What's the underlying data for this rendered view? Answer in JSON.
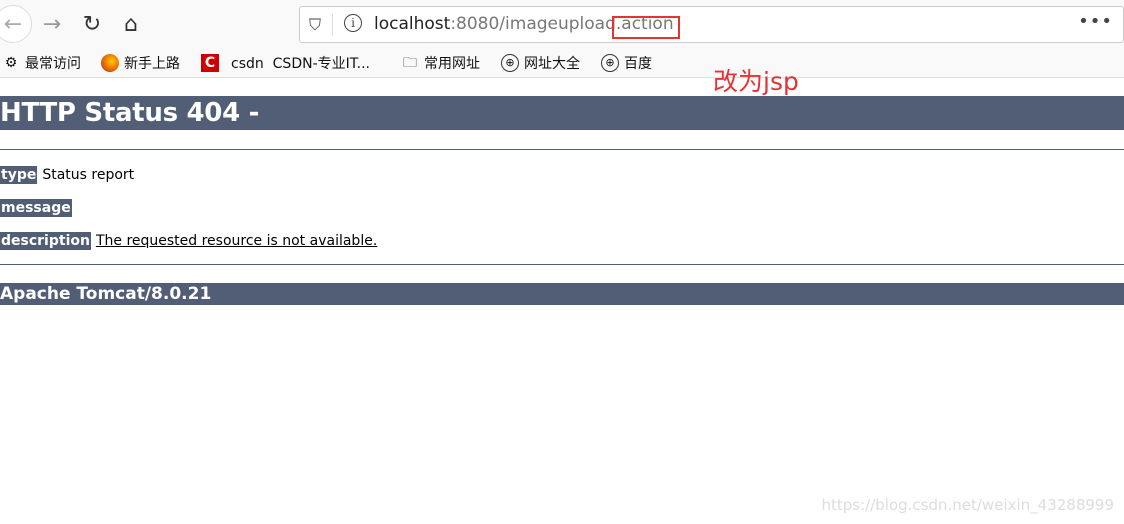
{
  "browser": {
    "url_host": "localhost",
    "url_rest": ":8080/imageupload.action",
    "more": "•••",
    "bookmarks": [
      {
        "label": "最常访问",
        "icon": "gear-icon"
      },
      {
        "label": "新手上路",
        "icon": "firefox-icon"
      },
      {
        "label": "csdn  CSDN-专业IT...",
        "icon": "csdn-icon"
      },
      {
        "label": "常用网址",
        "icon": "folder-icon"
      },
      {
        "label": "网址大全",
        "icon": "globe-icon"
      },
      {
        "label": "百度",
        "icon": "globe-icon"
      }
    ]
  },
  "annotation": "改为jsp",
  "annotation_color": "#e53333",
  "page": {
    "title": "HTTP Status 404 -",
    "type_label": "type",
    "type_value": "Status report",
    "message_label": "message",
    "description_label": "description",
    "description_value": "The requested resource is not available.",
    "footer": "Apache Tomcat/8.0.21",
    "accent": "#525d76"
  },
  "watermark": "https://blog.csdn.net/weixin_43288999"
}
